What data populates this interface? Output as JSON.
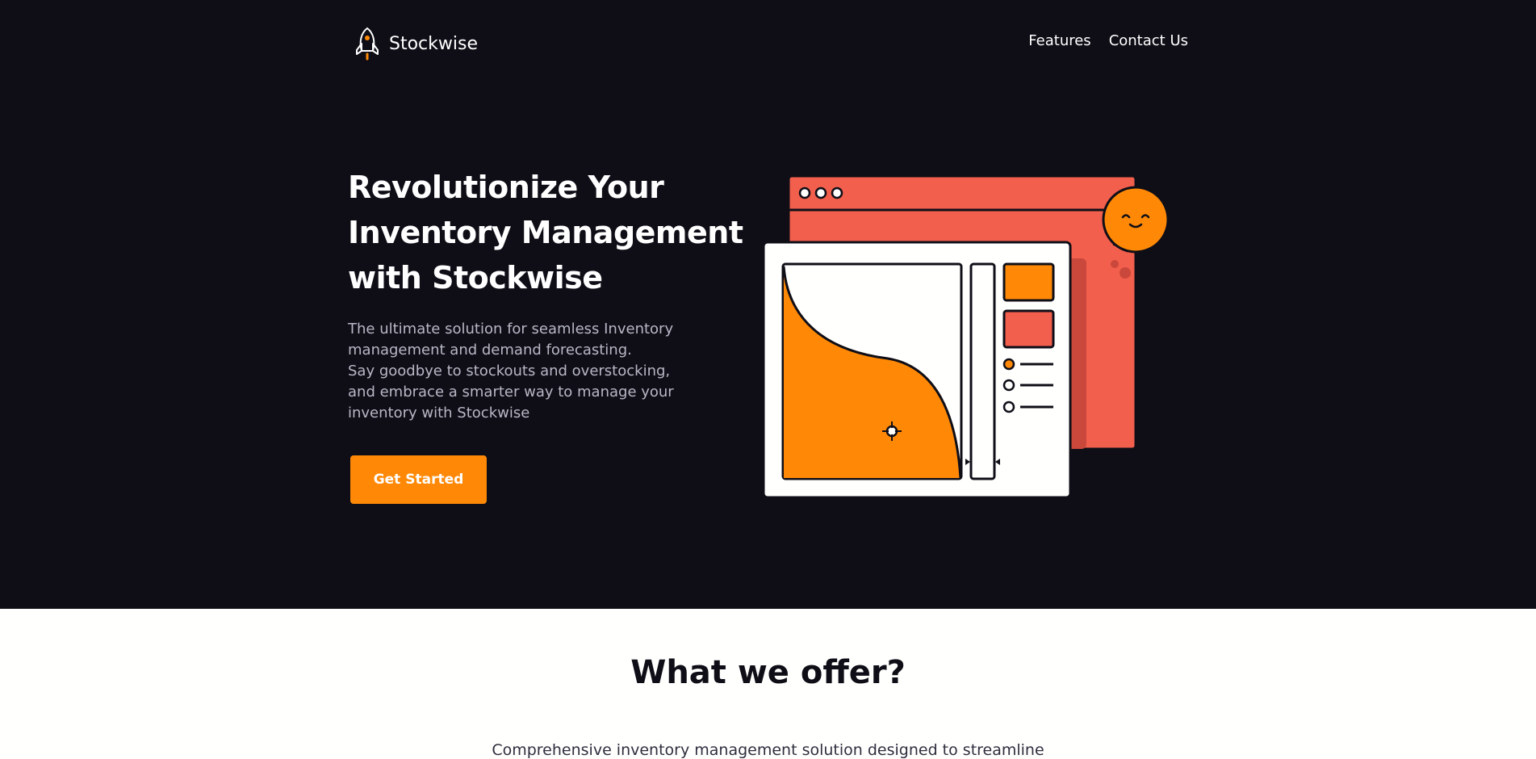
{
  "brand": {
    "name": "Stockwise",
    "logo_icon": "rocket-icon"
  },
  "nav": {
    "links": [
      "Features",
      "Contact Us"
    ]
  },
  "hero": {
    "title_lines": [
      "Revolutionize Your",
      "Inventory Management",
      "with Stockwise"
    ],
    "description_lines": [
      "The ultimate solution for seamless Inventory",
      "management and demand forecasting.",
      "Say goodbye to stockouts and overstocking,",
      "and embrace a smarter way to manage your",
      "inventory with Stockwise"
    ],
    "cta_label": "Get Started"
  },
  "offer": {
    "title": "What we offer?",
    "description": "Comprehensive inventory management solution designed to streamline"
  },
  "colors": {
    "background_dark": "#0f0e17",
    "accent_orange": "#ff8906",
    "illustration_red": "#f25f4c",
    "sun_pink": "#e53170"
  }
}
